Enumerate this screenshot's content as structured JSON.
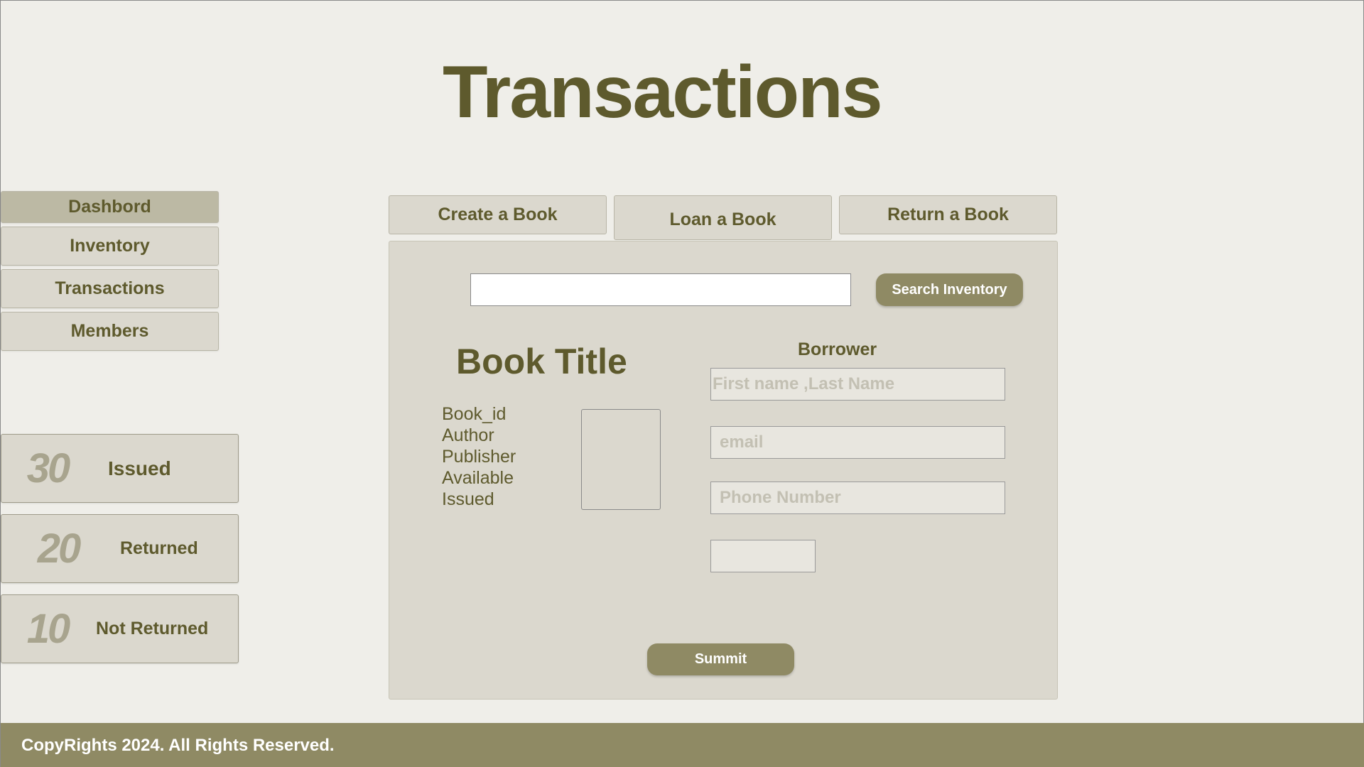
{
  "page": {
    "title": "Transactions"
  },
  "sidebar": {
    "items": [
      {
        "label": "Dashbord",
        "active": true
      },
      {
        "label": "Inventory"
      },
      {
        "label": "Transactions"
      },
      {
        "label": "Members"
      }
    ]
  },
  "stats": [
    {
      "value": "30",
      "label": "Issued"
    },
    {
      "value": "20",
      "label": "Returned"
    },
    {
      "value": "10",
      "label": "Not Returned"
    }
  ],
  "tabs": [
    {
      "label": "Create a Book"
    },
    {
      "label": "Loan a Book",
      "active": true
    },
    {
      "label": "Return a Book"
    }
  ],
  "search": {
    "value": "",
    "button_label": "Search Inventory"
  },
  "book": {
    "title": "Book Title",
    "fields": [
      "Book_id",
      "Author",
      "Publisher",
      "Available",
      "Issued"
    ]
  },
  "borrower": {
    "label": "Borrower",
    "name_placeholder": "First name ,Last Name",
    "email_placeholder": "email",
    "phone_placeholder": "Phone Number",
    "extra_value": ""
  },
  "form": {
    "submit_label": "Summit"
  },
  "footer": {
    "text": "CopyRights 2024. All Rights Reserved."
  },
  "colors": {
    "accent": "#8f8a64",
    "text": "#5e5a2d",
    "panel": "#dbd8ce",
    "background": "#efeee9"
  }
}
